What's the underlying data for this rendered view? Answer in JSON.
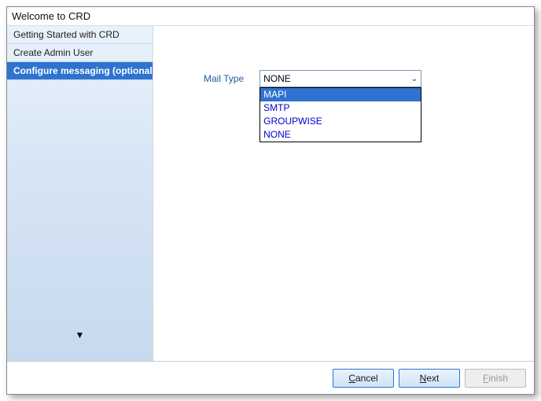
{
  "title": "Welcome to CRD",
  "sidebar": {
    "items": [
      {
        "label": "Getting Started with CRD",
        "active": false
      },
      {
        "label": "Create Admin User",
        "active": false
      },
      {
        "label": "Configure messaging (optional)",
        "active": true
      }
    ]
  },
  "main": {
    "mail_type_label": "Mail Type",
    "mail_type_value": "NONE",
    "mail_type_options": [
      "MAPI",
      "SMTP",
      "GROUPWISE",
      "NONE"
    ],
    "mail_type_highlighted": "MAPI"
  },
  "footer": {
    "cancel": "Cancel",
    "next": "Next",
    "finish": "Finish"
  }
}
